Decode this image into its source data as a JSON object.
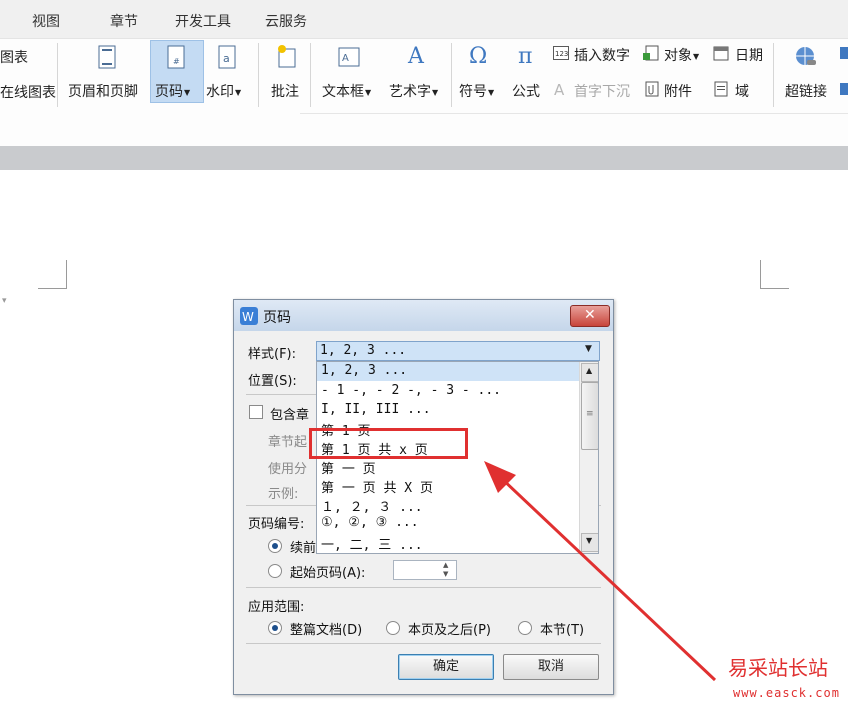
{
  "tabs": [
    "视图",
    "章节",
    "开发工具",
    "云服务"
  ],
  "ribbon": {
    "left_cut_top": "图表",
    "left_cut_bottom": "在线图表",
    "header_footer": "页眉和页脚",
    "page_number": "页码",
    "watermark": "水印",
    "comment": "批注",
    "textbox": "文本框",
    "wordart": "艺术字",
    "symbol": "符号",
    "formula": "公式",
    "insert_number": "插入数字",
    "object": "对象",
    "date": "日期",
    "dropcap": "首字下沉",
    "attachment": "附件",
    "field": "域",
    "hyperlink": "超链接"
  },
  "dialog": {
    "title": "页码",
    "style_label": "样式(F):",
    "style_value": "1, 2, 3 ...",
    "position_label": "位置(S):",
    "include_chapter": "包含章",
    "chapter_start": "章节起",
    "use_separator": "使用分",
    "example": "示例:",
    "numbering_label": "页码编号:",
    "continue": "续前",
    "start_page": "起始页码(A):",
    "scope_label": "应用范围:",
    "scope_whole": "整篇文档(D)",
    "scope_this_after": "本页及之后(P)",
    "scope_section": "本节(T)",
    "ok": "确定",
    "cancel": "取消"
  },
  "style_options": [
    "1, 2, 3 ...",
    "- 1 -, - 2 -, - 3 - ...",
    "I, II, III ...",
    "第 1 页",
    "第 1 页 共 x 页",
    "第 一 页",
    "第 一 页 共 X 页",
    "１, ２, ３ ...",
    "①, ②, ③ ...",
    "一, 二, 三 ..."
  ],
  "highlighted_option_index": 4,
  "watermark": {
    "text_cn": "易采站长站",
    "text_url": "www.easck.com"
  },
  "colors": {
    "annotation_red": "#e03030",
    "selection_blue": "#cfe3f7",
    "dialog_bg": "#f0f0f0"
  }
}
